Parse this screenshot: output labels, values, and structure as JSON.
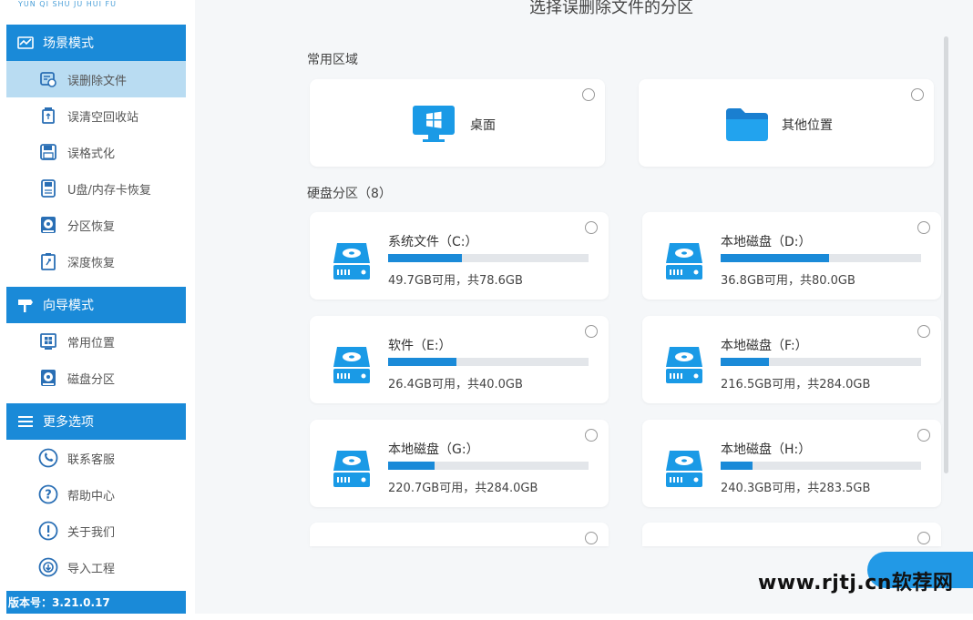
{
  "sidebar": {
    "logo_sub": "YUN QI SHU JU HUI FU",
    "scene_header": "场景模式",
    "scene_items": [
      {
        "label": "误删除文件",
        "icon": "file-restore-icon"
      },
      {
        "label": "误清空回收站",
        "icon": "recycle-bin-icon"
      },
      {
        "label": "误格式化",
        "icon": "save-disk-icon"
      },
      {
        "label": "U盘/内存卡恢复",
        "icon": "usb-card-icon"
      },
      {
        "label": "分区恢复",
        "icon": "partition-icon"
      },
      {
        "label": "深度恢复",
        "icon": "deep-recovery-icon"
      }
    ],
    "guide_header": "向导模式",
    "guide_items": [
      {
        "label": "常用位置",
        "icon": "windows-location-icon"
      },
      {
        "label": "磁盘分区",
        "icon": "disk-partition-icon"
      }
    ],
    "more_header": "更多选项",
    "more_items": [
      {
        "label": "联系客服",
        "icon": "phone-icon"
      },
      {
        "label": "帮助中心",
        "icon": "help-icon"
      },
      {
        "label": "关于我们",
        "icon": "info-icon"
      },
      {
        "label": "导入工程",
        "icon": "import-icon"
      }
    ],
    "version": "版本号：3.21.0.17"
  },
  "main": {
    "title": "选择误删除文件的分区",
    "common_label": "常用区域",
    "common_items": [
      {
        "label": "桌面",
        "icon": "desktop-windows-icon"
      },
      {
        "label": "其他位置",
        "icon": "folder-icon"
      }
    ],
    "disk_label": "硬盘分区（8）",
    "disks": [
      {
        "name": "系统文件（C:）",
        "size": "49.7GB可用，共78.6GB",
        "used_fraction": 0.37
      },
      {
        "name": "本地磁盘（D:）",
        "size": "36.8GB可用，共80.0GB",
        "used_fraction": 0.54
      },
      {
        "name": "软件（E:）",
        "size": "26.4GB可用，共40.0GB",
        "used_fraction": 0.34
      },
      {
        "name": "本地磁盘（F:）",
        "size": "216.5GB可用，共284.0GB",
        "used_fraction": 0.24
      },
      {
        "name": "本地磁盘（G:）",
        "size": "220.7GB可用，共284.0GB",
        "used_fraction": 0.23
      },
      {
        "name": "本地磁盘（H:）",
        "size": "240.3GB可用，共283.5GB",
        "used_fraction": 0.16
      }
    ]
  },
  "watermark": "www.rjtj.cn软荐网",
  "colors": {
    "accent": "#1a8ad8",
    "active_bg": "#b9dcf2",
    "bar_bg": "#e3e6ea"
  }
}
